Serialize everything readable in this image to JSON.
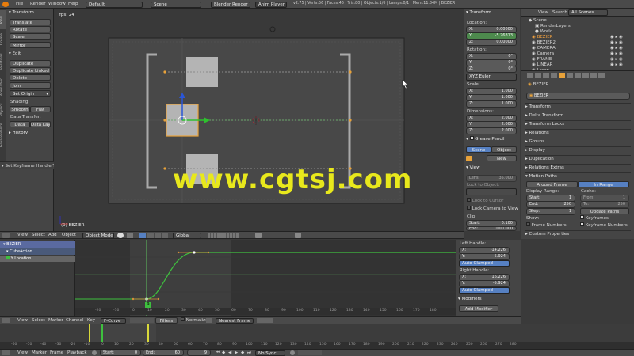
{
  "topbar": {
    "menus": [
      "File",
      "Render",
      "Window",
      "Help"
    ],
    "layout": "Default",
    "scene": "Scene",
    "engine": "Blender Render",
    "anim_player": "Anim Player",
    "stats": "v2.75 | Verts:56 | Faces:46 | Tris:80 | Objects:1/6 | Lamps:0/1 | Mem:11.84M | BEZIER"
  },
  "toolshelf": {
    "tabs": [
      "Tools",
      "Create",
      "Relations",
      "Animation",
      "Physics",
      "Grease Pencil"
    ],
    "transform_header": "Transform",
    "transform_buttons": [
      "Translate",
      "Rotate",
      "Scale",
      "Mirror"
    ],
    "edit_header": "Edit",
    "edit_buttons": [
      "Duplicate",
      "Duplicate Linked",
      "Delete",
      "Join"
    ],
    "set_origin": "Set Origin",
    "shading_label": "Shading:",
    "smooth": "Smooth",
    "flat": "Flat",
    "data_transfer_label": "Data Transfer:",
    "data": "Data",
    "data_layo": "Data Layo",
    "history": "History",
    "operator_panel": "Set Keyframe Handle Ty"
  },
  "viewport": {
    "fps": "fps: 24",
    "object_label": "(9) BEZIER",
    "watermark": "www.cgtsj.com",
    "header": {
      "menus": [
        "View",
        "Select",
        "Add",
        "Object"
      ],
      "mode": "Object Mode",
      "orientation": "Global"
    }
  },
  "npanel": {
    "transform": "Transform",
    "location": "Location:",
    "loc": [
      {
        "axis": "X:",
        "value": "0.00000"
      },
      {
        "axis": "Y:",
        "value": "-5.76813"
      },
      {
        "axis": "Z:",
        "value": "0.00000"
      }
    ],
    "rotation": "Rotation:",
    "rot": [
      {
        "axis": "X:",
        "value": "0°"
      },
      {
        "axis": "Y:",
        "value": "0°"
      },
      {
        "axis": "Z:",
        "value": "0°"
      }
    ],
    "euler": "XYZ Euler",
    "scale": "Scale:",
    "scl": [
      {
        "axis": "X:",
        "value": "1.000"
      },
      {
        "axis": "Y:",
        "value": "1.000"
      },
      {
        "axis": "Z:",
        "value": "1.000"
      }
    ],
    "dimensions": "Dimensions:",
    "dim": [
      {
        "axis": "X:",
        "value": "2.000"
      },
      {
        "axis": "Y:",
        "value": "2.000"
      },
      {
        "axis": "Z:",
        "value": "2.000"
      }
    ],
    "grease_pencil": "Grease Pencil",
    "gp_scene": "Scene",
    "gp_object": "Object",
    "gp_new": "New",
    "view": "View",
    "lens_label": "Lens:",
    "lens": "35.000",
    "lock_to_object": "Lock to Object:",
    "lock_to_cursor": "Lock to Cursor",
    "lock_camera": "Lock Camera to View",
    "clip": "Clip:",
    "clip_start_label": "Start:",
    "clip_start": "0.100",
    "clip_end_label": "End:",
    "clip_end": "1000.000"
  },
  "outliner": {
    "menus": [
      "View",
      "Search"
    ],
    "filter": "All Scenes",
    "items": [
      "Scene",
      "RenderLayers",
      "World",
      "BEZIER",
      "BEZIER2",
      "CAMERA",
      "Camera",
      "FRAME",
      "LINEAR",
      "Lamp"
    ]
  },
  "properties": {
    "breadcrumb": "BEZIER",
    "object_name": "BEZIER",
    "panels": [
      "Transform",
      "Delta Transform",
      "Transform Locks",
      "Relations",
      "Groups",
      "Display",
      "Duplication",
      "Relations Extras"
    ],
    "motion_paths": "Motion Paths",
    "around_frame": "Around Frame",
    "in_range": "In Range",
    "display_range": "Display Range:",
    "cache": "Cache:",
    "start_label": "Start:",
    "start": "1",
    "end_label": "End:",
    "end": "250",
    "step_label": "Step:",
    "step": "1",
    "from_label": "From:",
    "from": "1",
    "to_label": "To:",
    "to": "250",
    "update_paths": "Update Paths",
    "show": "Show:",
    "keyframes": "Keyframes",
    "frame_numbers": "Frame Numbers",
    "keyframe_numbers": "Keyframe Numbers",
    "custom_properties": "Custom Properties"
  },
  "graph_editor": {
    "channels": [
      "BEZIER",
      "CubeAction",
      "Y Location"
    ],
    "header": {
      "menus": [
        "View",
        "Select",
        "Marker",
        "Channel",
        "Key"
      ],
      "mode": "F-Curve",
      "filters": "Filters",
      "normalize": "Normalize",
      "interp": "Nearest Frame"
    },
    "frame_marker": "9",
    "ticks": [
      "-20",
      "-10",
      "0",
      "10",
      "20",
      "30",
      "40",
      "50",
      "60",
      "70",
      "80",
      "90",
      "100",
      "110",
      "120",
      "130",
      "140",
      "150",
      "160",
      "170",
      "180"
    ],
    "left_handle": "Left Handle:",
    "lh": [
      {
        "axis": "X:",
        "value": "-14.226"
      },
      {
        "axis": "Y:",
        "value": "-5.924"
      }
    ],
    "lh_type": "Auto Clamped",
    "right_handle": "Right Handle:",
    "rh": [
      {
        "axis": "X:",
        "value": "16.226"
      },
      {
        "axis": "Y:",
        "value": "-5.924"
      }
    ],
    "rh_type": "Auto Clamped",
    "modifiers": "Modifiers",
    "add_modifier": "Add Modifier"
  },
  "timeline": {
    "menus": [
      "View",
      "Marker",
      "Frame",
      "Playback"
    ],
    "start_label": "Start:",
    "start": "0",
    "end_label": "End:",
    "end": "60",
    "current": "9",
    "sync": "No Sync",
    "ticks": [
      "-60",
      "-50",
      "-40",
      "-30",
      "-20",
      "-10",
      "0",
      "10",
      "20",
      "30",
      "40",
      "50",
      "60",
      "70",
      "80",
      "90",
      "100",
      "110",
      "120",
      "130",
      "140",
      "150",
      "160",
      "170",
      "180",
      "190",
      "200",
      "210",
      "220",
      "230",
      "240",
      "250",
      "260",
      "270",
      "280"
    ]
  }
}
